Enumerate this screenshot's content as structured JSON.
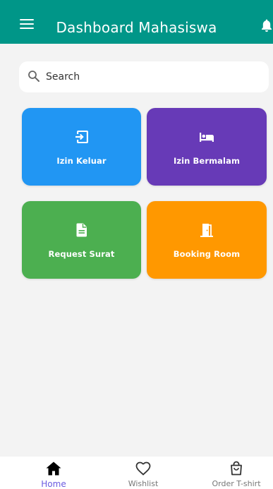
{
  "appbar": {
    "title": "Dashboard Mahasiswa",
    "menu_icon": "menu-icon",
    "notification_icon": "bell-icon",
    "background_color": "#009688"
  },
  "search": {
    "placeholder": "Search",
    "value": ""
  },
  "menu_cards": [
    {
      "label": "Izin Keluar",
      "icon": "exit-icon",
      "color": "#2196f3"
    },
    {
      "label": "Izin Bermalam",
      "icon": "bed-icon",
      "color": "#673ab7"
    },
    {
      "label": "Request Surat",
      "icon": "document-icon",
      "color": "#4caf50"
    },
    {
      "label": "Booking Room",
      "icon": "door-icon",
      "color": "#ff9800"
    }
  ],
  "bottom_nav": {
    "items": [
      {
        "label": "Home",
        "icon": "home-icon",
        "active": true
      },
      {
        "label": "Wishlist",
        "icon": "heart-icon",
        "active": false
      },
      {
        "label": "Order T-shirt",
        "icon": "shopping-bag-icon",
        "active": false
      }
    ],
    "active_color": "#6a5ae0"
  }
}
